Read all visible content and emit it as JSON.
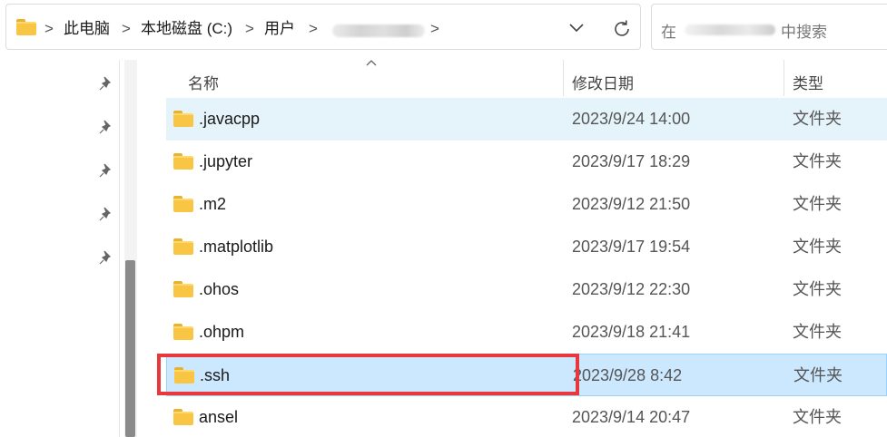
{
  "address_bar": {
    "crumbs": [
      "此电脑",
      "本地磁盘 (C:)",
      "用户"
    ],
    "separator": ">"
  },
  "search": {
    "prefix": "在",
    "suffix": "中搜索"
  },
  "columns": {
    "name": "名称",
    "modified": "修改日期",
    "type": "类型"
  },
  "rows": [
    {
      "name": ".javacpp",
      "date": "2023/9/24 14:00",
      "type": "文件夹"
    },
    {
      "name": ".jupyter",
      "date": "2023/9/17 18:29",
      "type": "文件夹"
    },
    {
      "name": ".m2",
      "date": "2023/9/12 21:50",
      "type": "文件夹"
    },
    {
      "name": ".matplotlib",
      "date": "2023/9/17 19:54",
      "type": "文件夹"
    },
    {
      "name": ".ohos",
      "date": "2023/9/12 22:30",
      "type": "文件夹"
    },
    {
      "name": ".ohpm",
      "date": "2023/9/18 21:41",
      "type": "文件夹"
    },
    {
      "name": ".ssh",
      "date": "2023/9/28 8:42",
      "type": "文件夹"
    },
    {
      "name": "ansel",
      "date": "2023/9/14 20:47",
      "type": "文件夹"
    }
  ],
  "colors": {
    "selected_row": "#cce8ff",
    "hover_row": "#e5f3fb",
    "highlight_box": "#e8383d",
    "folder": "#f8c544"
  }
}
